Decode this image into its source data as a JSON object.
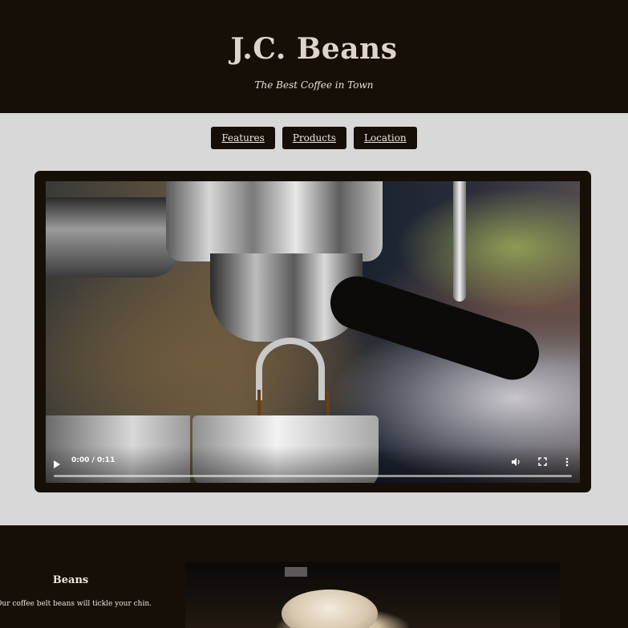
{
  "header": {
    "title": "J.C. Beans",
    "tagline": "The Best Coffee in Town"
  },
  "nav": {
    "items": [
      {
        "label": "Features"
      },
      {
        "label": "Products"
      },
      {
        "label": "Location"
      }
    ]
  },
  "video": {
    "time": "0:00 / 0:11",
    "progress": 0,
    "icons": [
      "play-icon",
      "volume-icon",
      "fullscreen-icon",
      "more-options-icon"
    ]
  },
  "features": {
    "items": [
      {
        "title": "Beans",
        "text": "Our coffee belt beans will tickle your chin."
      }
    ]
  },
  "colors": {
    "dark": "#150f07",
    "light": "#d8d8d8",
    "text": "#ddd5cb"
  }
}
